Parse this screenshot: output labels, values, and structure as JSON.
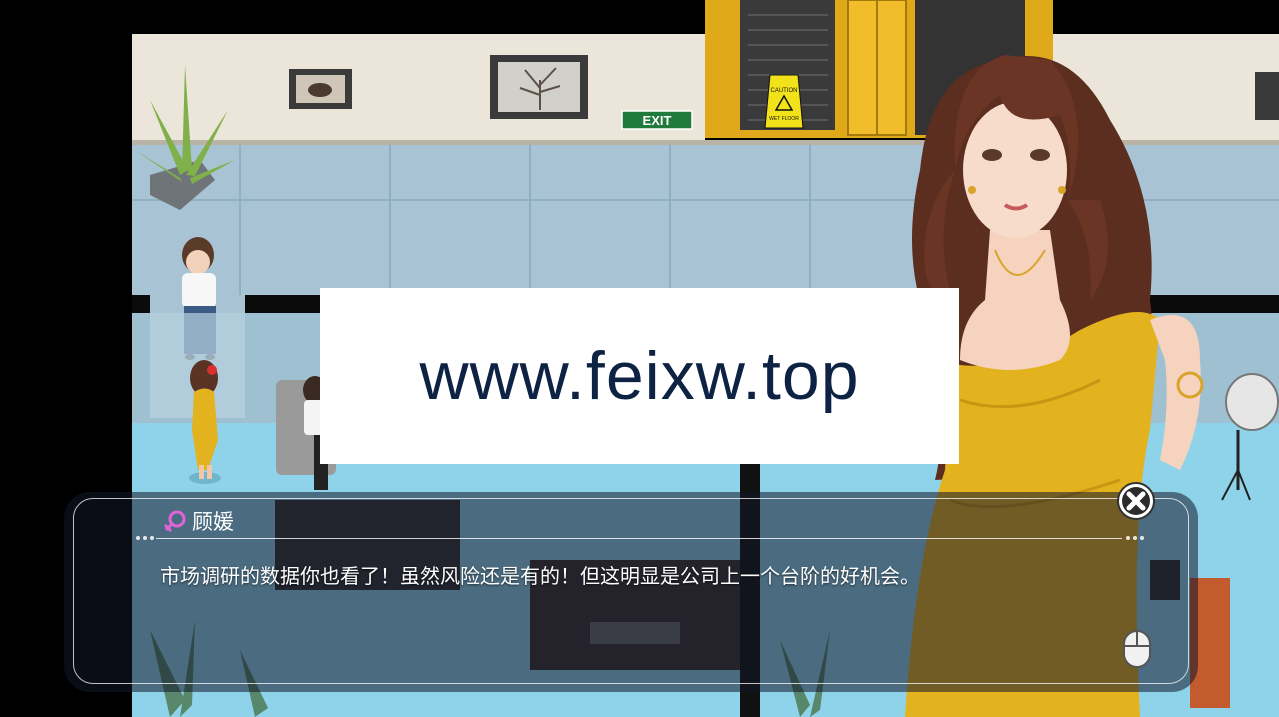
{
  "scene": {
    "signs": {
      "exit": "EXIT",
      "caution": "CAUTION",
      "wet_floor": "WET FLOOR"
    }
  },
  "watermark": {
    "text": "www.feixw.top"
  },
  "dialogue": {
    "speaker_icon": "female-symbol-icon",
    "speaker": "顾媛",
    "text": "市场调研的数据你也看了！虽然风险还是有的！但这明显是公司上一个台阶的好机会。"
  },
  "controls": {
    "close_icon": "close-icon",
    "advance_icon": "mouse-icon"
  },
  "colors": {
    "dress": "#e3b21f",
    "floor": "#8fd3ea",
    "wall": "#a9c6d6",
    "dialog_bg": "#121628",
    "speaker_icon": "#e262d8"
  }
}
